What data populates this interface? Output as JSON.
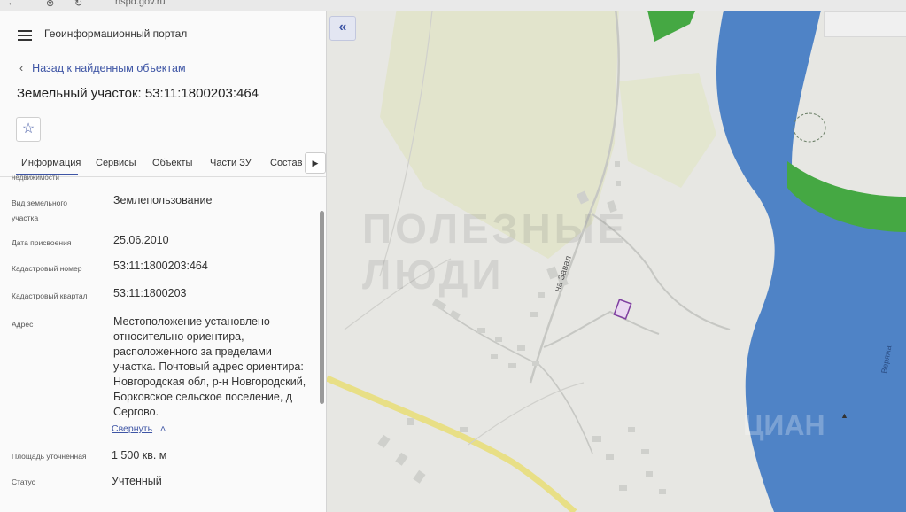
{
  "browser": {
    "url": "nspd.gov.ru"
  },
  "header": {
    "portal_title": "Геоинформационный портал"
  },
  "navigation": {
    "back_label": "Назад к найденным объектам"
  },
  "page": {
    "title": "Земельный участок: 53:11:1800203:464"
  },
  "tabs": [
    "Информация",
    "Сервисы",
    "Объекты",
    "Части ЗУ",
    "Состав"
  ],
  "fields": {
    "cutoff_label": "недвижимости",
    "land_use_label_line1": "Вид земельного",
    "land_use_label_line2": "участка",
    "land_use_value": "Землепользование",
    "date_label": "Дата присвоения",
    "date_value": "25.06.2010",
    "cadastral_number_label": "Кадастровый номер",
    "cadastral_number_value": "53:11:1800203:464",
    "cadastral_quarter_label": "Кадастровый квартал",
    "cadastral_quarter_value": "53:11:1800203",
    "address_label": "Адрес",
    "address_value": "Местоположение установлено относительно ориентира, расположенного за пределами участка. Почтовый адрес ориентира: Новгородская обл, р-н Новгородский, Борковское сельское поселение, д Сергово.",
    "collapse_label": "Свернуть",
    "area_label": "Площадь уточненная",
    "area_value": "1 500 кв. м",
    "status_label": "Статус",
    "status_value": "Учтенный"
  },
  "map": {
    "street_label": "на Завал",
    "river_label": "Веряжа",
    "watermark_main": "ПОЛЕЗНЫЕ ЛЮДИ",
    "watermark_corner": "ЦИАН",
    "colors": {
      "land": "#e7e7e3",
      "field": "#e2e4cc",
      "water": "#4f83c6",
      "forest": "#45a843",
      "road": "#e8df86",
      "parcel": "#7f3fa0"
    }
  },
  "icons": [
    "menu-icon",
    "chevron-left-icon",
    "star-icon",
    "chevron-right-icon",
    "double-chevron-left-icon"
  ]
}
